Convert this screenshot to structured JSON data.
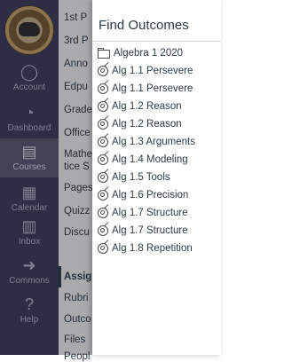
{
  "global_nav": {
    "items": [
      {
        "label": "Account",
        "icon": "user-circle-icon"
      },
      {
        "label": "Dashboard",
        "icon": "dashboard-icon"
      },
      {
        "label": "Courses",
        "icon": "book-icon",
        "active": true
      },
      {
        "label": "Calendar",
        "icon": "calendar-icon"
      },
      {
        "label": "Inbox",
        "icon": "inbox-icon"
      },
      {
        "label": "Commons",
        "icon": "commons-icon"
      },
      {
        "label": "Help",
        "icon": "question-icon"
      }
    ]
  },
  "course_nav": {
    "items": [
      {
        "label": "1st P"
      },
      {
        "label": "3rd P"
      },
      {
        "label": "Anno"
      },
      {
        "label": "Edpu"
      },
      {
        "label": "Grade"
      },
      {
        "label": "Office"
      },
      {
        "label": "Mathe"
      },
      {
        "label": "tice S"
      },
      {
        "label": "Pages"
      },
      {
        "label": "Quizz"
      },
      {
        "label": "Discu"
      },
      {
        "label": "Assig",
        "active": true
      },
      {
        "label": "Rubri"
      },
      {
        "label": "Outco"
      },
      {
        "label": "Files"
      },
      {
        "label": "Peopl"
      }
    ]
  },
  "tray": {
    "title": "Find Outcomes",
    "items": [
      {
        "label": "Algebra 1 2020",
        "type": "folder"
      },
      {
        "label": "Alg 1.1 Persevere",
        "type": "outcome"
      },
      {
        "label": "Alg 1.1 Persevere",
        "type": "outcome"
      },
      {
        "label": "Alg 1.2 Reason",
        "type": "outcome"
      },
      {
        "label": "Alg 1.2 Reason",
        "type": "outcome"
      },
      {
        "label": "Alg 1.3 Arguments",
        "type": "outcome"
      },
      {
        "label": "Alg 1.4 Modeling",
        "type": "outcome"
      },
      {
        "label": "Alg 1.5 Tools",
        "type": "outcome"
      },
      {
        "label": "Alg 1.6 Precision",
        "type": "outcome"
      },
      {
        "label": "Alg 1.7 Structure",
        "type": "outcome"
      },
      {
        "label": "Alg 1.7 Structure",
        "type": "outcome"
      },
      {
        "label": "Alg 1.8 Repetition",
        "type": "outcome"
      }
    ]
  }
}
